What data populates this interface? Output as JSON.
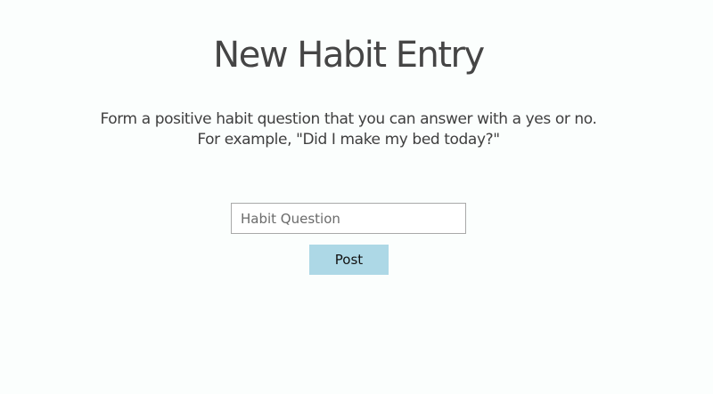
{
  "header": {
    "title": "New Habit Entry"
  },
  "instructions": {
    "line1": "Form a positive habit question that you can answer with a yes or no.",
    "line2": "For example, \"Did I make my bed today?\""
  },
  "form": {
    "habit_input": {
      "value": "",
      "placeholder": "Habit Question"
    },
    "post_label": "Post"
  },
  "colors": {
    "background": "#fbfefd",
    "button": "#add8e6",
    "text": "#454545"
  }
}
